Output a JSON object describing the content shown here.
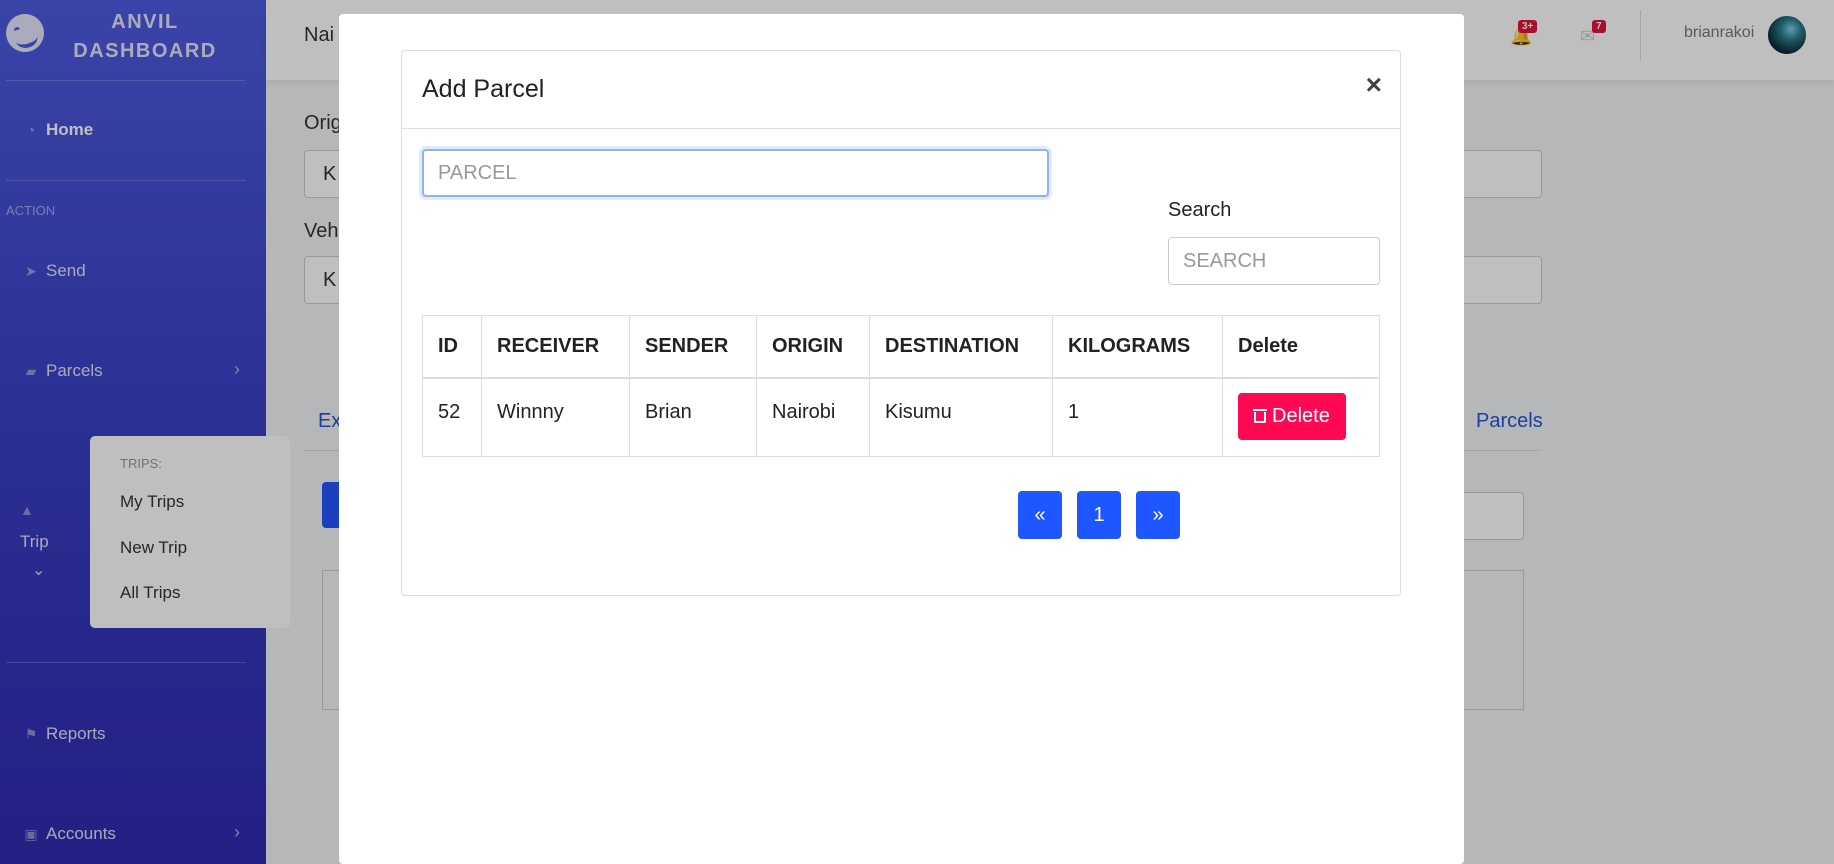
{
  "brand": {
    "title_line1": "ANVIL",
    "title_line2": "DASHBOARD"
  },
  "sidebar": {
    "home": "Home",
    "action_label": "ACTION",
    "send": "Send",
    "parcels": "Parcels",
    "trip": "Trip",
    "reports": "Reports",
    "accounts": "Accounts"
  },
  "trips_menu": {
    "header": "TRIPS:",
    "items": [
      "My Trips",
      "New Trip",
      "All Trips"
    ]
  },
  "topbar": {
    "crumb": "Nai",
    "notifications_badge": "3+",
    "messages_badge": "7",
    "username": "brianrakoi"
  },
  "background": {
    "origin_label": "Orig",
    "origin_value": "K",
    "vehicle_label": "Veh",
    "vehicle_value": "K",
    "tab_left": "Ex",
    "tab_right": "Parcels"
  },
  "modal": {
    "title": "Add Parcel",
    "close": "×",
    "parcel_placeholder": "PARCEL",
    "search_label": "Search",
    "search_placeholder": "SEARCH",
    "columns": [
      "ID",
      "RECEIVER",
      "SENDER",
      "ORIGIN",
      "DESTINATION",
      "KILOGRAMS",
      "Delete"
    ],
    "rows": [
      {
        "id": "52",
        "receiver": "Winnny",
        "sender": "Brian",
        "origin": "Nairobi",
        "destination": "Kisumu",
        "kilograms": "1",
        "delete": "Delete"
      }
    ],
    "pagination": {
      "prev": "«",
      "page": "1",
      "next": "»"
    }
  }
}
